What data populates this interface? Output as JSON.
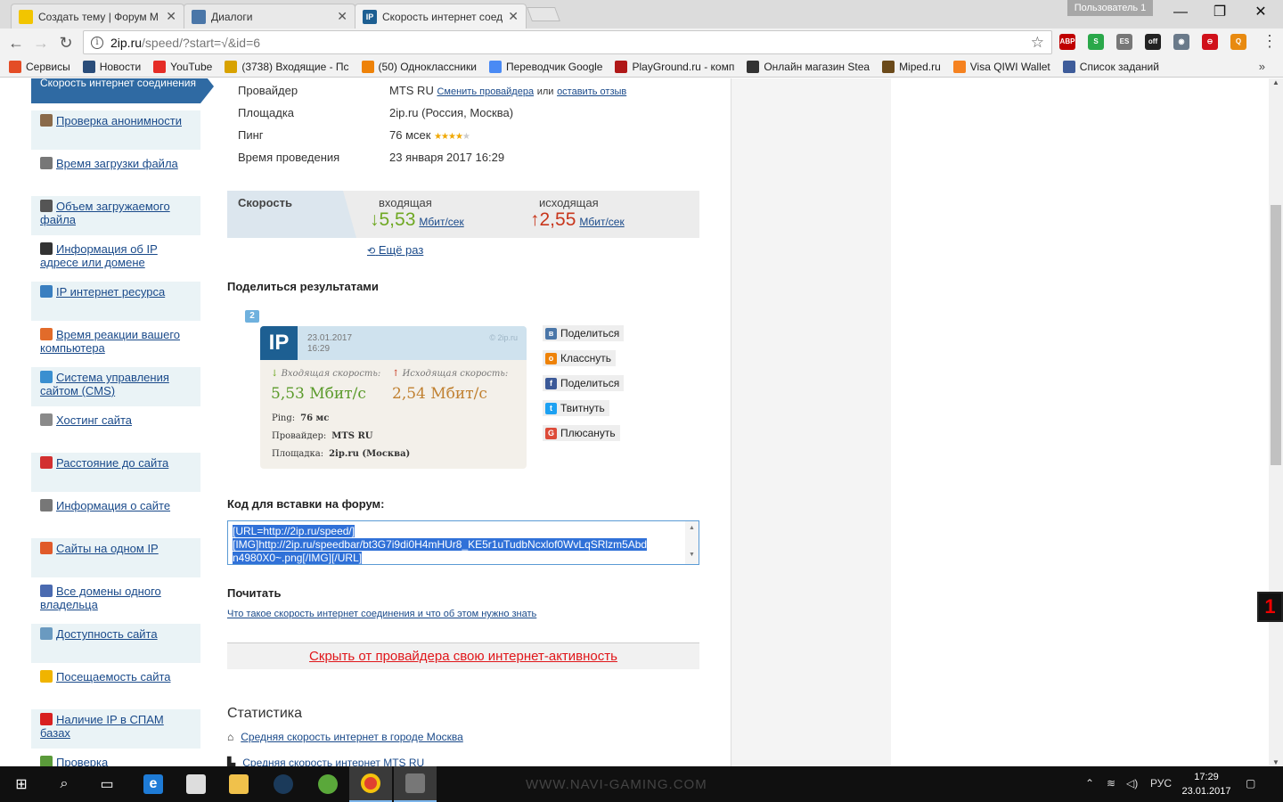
{
  "tabs": [
    {
      "title": "Создать тему | Форум M",
      "color": "#f2c500"
    },
    {
      "title": "Диалоги",
      "color": "#4a76a8"
    },
    {
      "title": "Скорость интернет соед",
      "color": "#1d5f92"
    }
  ],
  "profile": "Пользователь 1",
  "address": {
    "host": "2ip.ru",
    "path": "/speed/?start=√&id=6"
  },
  "bookmarks": [
    {
      "label": "Сервисы",
      "color": "#e44d26"
    },
    {
      "label": "Новости",
      "color": "#2a4d7a"
    },
    {
      "label": "YouTube",
      "color": "#e52d27"
    },
    {
      "label": "(3738) Входящие - Пс",
      "color": "#d8a200"
    },
    {
      "label": "(50) Одноклассники",
      "color": "#ee8208"
    },
    {
      "label": "Переводчик Google",
      "color": "#4a8af4"
    },
    {
      "label": "PlayGround.ru - комп",
      "color": "#b01818"
    },
    {
      "label": "Онлайн магазин Stea",
      "color": "#333333"
    },
    {
      "label": "Miped.ru",
      "color": "#6b4a1a"
    },
    {
      "label": "Visa QIWI Wallet",
      "color": "#f58220"
    },
    {
      "label": "Список заданий",
      "color": "#3e5c9a"
    }
  ],
  "sidebar": {
    "active": "Скорость интернет соединения",
    "items": [
      {
        "label": "Проверка анонимности",
        "icon": "user-icon",
        "color": "#8a6a4a"
      },
      {
        "label": "Время загрузки файла",
        "icon": "clock-icon",
        "color": "#777777"
      },
      {
        "label": "Объем загружаемого файла",
        "icon": "file-icon",
        "color": "#555555"
      },
      {
        "label": "Информация об IP адресе или домене",
        "icon": "ip-icon",
        "color": "#333333"
      },
      {
        "label": "IP интернет ресурса",
        "icon": "globe-icon",
        "color": "#3a7fc0"
      },
      {
        "label": "Время реакции вашего компьютера",
        "icon": "reaction-icon",
        "color": "#e26b2a"
      },
      {
        "label": "Система управления сайтом (CMS)",
        "icon": "cms-icon",
        "color": "#3a8fd0"
      },
      {
        "label": "Хостинг сайта",
        "icon": "hosting-icon",
        "color": "#8a8a8a"
      },
      {
        "label": "Расстояние до сайта",
        "icon": "pin-icon",
        "color": "#d23030"
      },
      {
        "label": "Информация о сайте",
        "icon": "doc-icon",
        "color": "#777777"
      },
      {
        "label": "Сайты на одном IP",
        "icon": "network-icon",
        "color": "#e05a2a"
      },
      {
        "label": "Все домены одного владельца",
        "icon": "owner-icon",
        "color": "#4a6ab0"
      },
      {
        "label": "Доступность сайта",
        "icon": "avail-icon",
        "color": "#6a9ac0"
      },
      {
        "label": "Посещаемость сайта",
        "icon": "star-icon",
        "color": "#f0b400"
      },
      {
        "label": "Наличие IP в СПАМ базах",
        "icon": "spam-icon",
        "color": "#d82020"
      },
      {
        "label": "Проверка",
        "icon": "check-icon",
        "color": "#5a9a3a"
      }
    ]
  },
  "info": [
    {
      "label": "Провайдер",
      "value": "MTS RU"
    },
    {
      "label": "Площадка",
      "value": "2ip.ru (Россия, Москва)"
    },
    {
      "label": "Пинг",
      "value": "76 мсек"
    },
    {
      "label": "Время проведения",
      "value": "23 января 2017 16:29"
    }
  ],
  "provider_links": {
    "change": "Сменить провайдера",
    "or": "или",
    "review": "оставить отзыв"
  },
  "ping_rating": 4,
  "speed": {
    "label": "Скорость",
    "in_label": "входящая",
    "in_value": "5,53",
    "in_unit": "Мбит/сек",
    "out_label": "исходящая",
    "out_value": "2,55",
    "out_unit": "Мбит/сек",
    "in_color": "#6fa823",
    "out_color": "#c8361c"
  },
  "again": "Ещё раз",
  "share_title": "Поделиться результатами",
  "card": {
    "badge": "2",
    "logo": "IP",
    "date": "23.01.2017",
    "time": "16:29",
    "watermark": "© 2ip.ru",
    "in_label": "Входящая скорость:",
    "out_label": "Исходящая скорость:",
    "in_value": "5,53 Мбит/с",
    "out_value": "2,54 Мбит/с",
    "ping_label": "Ping:",
    "ping_value": "76 мс",
    "provider_label": "Провайдер:",
    "provider_value": "MTS RU",
    "site_label": "Площадка:",
    "site_value": "2ip.ru (Москва)"
  },
  "share_buttons": [
    {
      "label": "Поделиться",
      "icon": "vk-icon",
      "color": "#4a76a8",
      "glyph": "в"
    },
    {
      "label": "Класснуть",
      "icon": "ok-icon",
      "color": "#ee8208",
      "glyph": "о"
    },
    {
      "label": "Поделиться",
      "icon": "facebook-icon",
      "color": "#3b5998",
      "glyph": "f"
    },
    {
      "label": "Твитнуть",
      "icon": "twitter-icon",
      "color": "#1da1f2",
      "glyph": "t"
    },
    {
      "label": "Плюсануть",
      "icon": "google-plus-icon",
      "color": "#dd4b39",
      "glyph": "G"
    }
  ],
  "code_title": "Код для вставки на форум:",
  "code_lines": [
    "[URL=http://2ip.ru/speed/]",
    "[IMG]http://2ip.ru/speedbar/bt3G7i9di0H4mHUr8_KE5r1uTudbNcxlof0WvLqSRlzm5Abd",
    "n4980X0~.png[/IMG][/URL]"
  ],
  "read_title": "Почитать",
  "read_link": "Что такое скорость интернет соединения и что об этом нужно знать",
  "hide_link": "Скрыть от провайдера свою интернет-активность",
  "stats_title": "Статистика",
  "stats": [
    "Средняя скорость интернет в городе Москва",
    "Средняя скорость интернет MTS RU"
  ],
  "floater": "1",
  "taskbar": {
    "watermark": "WWW.NAVI-GAMING.COM",
    "lang": "РУС",
    "time": "17:29",
    "date": "23.01.2017"
  },
  "extensions": [
    {
      "name": "adblock-icon",
      "color": "#c00000",
      "text": "ABP"
    },
    {
      "name": "grammar-icon",
      "color": "#2aa84a",
      "text": "S"
    },
    {
      "name": "es-icon",
      "color": "#777777",
      "text": "ES"
    },
    {
      "name": "proxy-icon",
      "color": "#222222",
      "text": "off"
    },
    {
      "name": "eye-icon",
      "color": "#6a7a8a",
      "text": "◉"
    },
    {
      "name": "block-icon",
      "color": "#d0101a",
      "text": "⊖"
    },
    {
      "name": "search-ext-icon",
      "color": "#e88a10",
      "text": "Q"
    }
  ]
}
